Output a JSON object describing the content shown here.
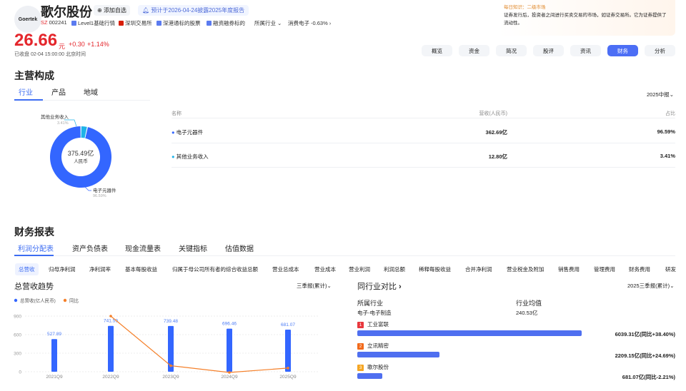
{
  "header": {
    "logo_text": "Goertek",
    "name": "歌尔股份",
    "add_watch": "添加自选",
    "notice": "预计于2026-04-24披露2025年度报告",
    "market": "SZ",
    "code": "002241",
    "tags": [
      "Level1基础行情",
      "深圳交易所",
      "深港通标的股票",
      "融资融券标的"
    ],
    "industry_label": "所属行业",
    "industry_name": "消费电子",
    "industry_change": "-0.63%",
    "price": "26.66",
    "unit": "元",
    "change": "+0.30",
    "change_pct": "+1.14%",
    "status": "已收盘 02-04 15:00:00 北京时间"
  },
  "knowledge": {
    "title": "每日知识：二级市场",
    "body": "证券发行后，投资者之间进行买卖交易的市场，如证券交易所。它为证券提供了流动性。"
  },
  "nav": [
    "概览",
    "资金",
    "简况",
    "股评",
    "资讯",
    "财务",
    "分析"
  ],
  "nav_active": 5,
  "composition": {
    "title": "主营构成",
    "tabs": [
      "行业",
      "产品",
      "地域"
    ],
    "period": "2025中报",
    "center_value": "375.49亿",
    "center_unit": "人民币",
    "columns": [
      "名称",
      "营收(人民币)",
      "占比"
    ],
    "rows": [
      {
        "name": "电子元器件",
        "revenue": "362.69亿",
        "pct": "96.59%",
        "share": 96.59,
        "color": "#3366ff"
      },
      {
        "name": "其他业务收入",
        "revenue": "12.80亿",
        "pct": "3.41%",
        "share": 3.41,
        "color": "#1fb3e8"
      }
    ]
  },
  "finance": {
    "title": "财务报表",
    "tabs": [
      "利润分配表",
      "资产负债表",
      "现金流量表",
      "关键指标",
      "估值数据"
    ],
    "subtabs": [
      "总营收",
      "归母净利润",
      "净利润率",
      "基本每股收益",
      "归属于母公司所有者的综合收益总额",
      "营业总成本",
      "营业成本",
      "营业利润",
      "利润总额",
      "稀释每股收益",
      "合并净利润",
      "营业税金及附加",
      "销售费用",
      "管理费用",
      "财务费用",
      "研发"
    ]
  },
  "trend": {
    "title": "总营收趋势",
    "period": "三季报(累计)"
  },
  "chart_data": {
    "type": "bar",
    "title": "总营收趋势",
    "categories": [
      "2021Q9",
      "2022Q9",
      "2023Q9",
      "2024Q9",
      "2025Q9"
    ],
    "series": [
      {
        "name": "总营收(亿人民币)",
        "values": [
          527.89,
          741.59,
          739.48,
          696.46,
          681.07
        ],
        "labels": [
          "527.89",
          "741.59",
          "739.48",
          "696.46",
          "681.07"
        ],
        "color": "#3366ff"
      },
      {
        "name": "同比",
        "type": "line",
        "values": [
          null,
          40.48,
          -0.28,
          -5.82,
          -2.21
        ],
        "color": "#f5802a"
      }
    ],
    "yticks": [
      "0",
      "300",
      "600",
      "900"
    ],
    "ylim": [
      0,
      900
    ]
  },
  "peers": {
    "title": "同行业对比",
    "period": "2025三季报(累计)",
    "industry_label": "所属行业",
    "industry": "电子-电子制造",
    "avg_label": "行业均值",
    "avg": "240.53亿",
    "items": [
      {
        "rank": "1",
        "name": "工业富联",
        "value": 6039.31,
        "text": "6039.31亿(同比+38.40%)",
        "color": "#e8383d"
      },
      {
        "rank": "2",
        "name": "立讯精密",
        "value": 2209.15,
        "text": "2209.15亿(同比+24.69%)",
        "color": "#f26a1b"
      },
      {
        "rank": "3",
        "name": "歌尔股份",
        "value": 681.07,
        "text": "681.07亿(同比-2.21%)",
        "color": "#f5a623"
      }
    ]
  }
}
